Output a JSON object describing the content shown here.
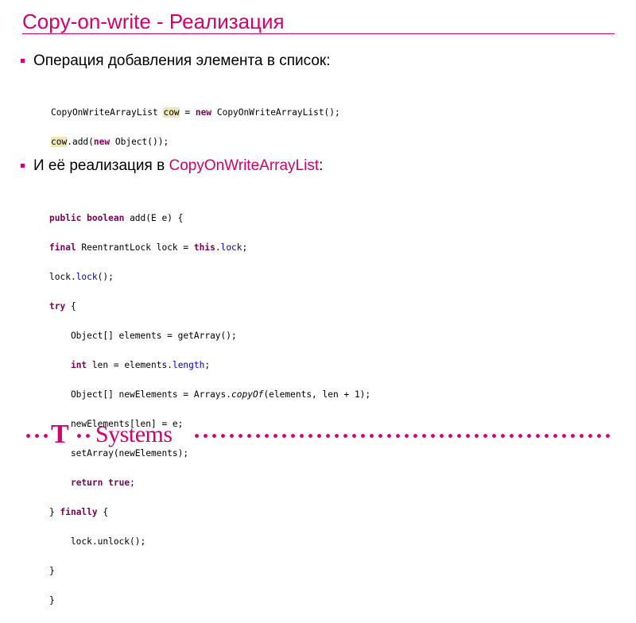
{
  "slide": {
    "title": "Copy-on-write - Реализация",
    "bullets": [
      {
        "text": "Операция добавления элемента в список:"
      },
      {
        "prefix": "И её реализация в ",
        "accent": "CopyOnWriteArrayList",
        "suffix": ":"
      }
    ],
    "code_usage": [
      "CopyOnWriteArrayList cow = new CopyOnWriteArrayList();",
      "cow.add(new Object());"
    ],
    "code_impl": [
      "public boolean add(E e) {",
      "final ReentrantLock lock = this.lock;",
      "lock.lock();",
      "try {",
      "    Object[] elements = getArray();",
      "    int len = elements.length;",
      "    Object[] newElements = Arrays.copyOf(elements, len + 1);",
      "    newElements[len] = e;",
      "    setArray(newElements);",
      "    return true;",
      "} finally {",
      "    lock.unlock();",
      "}",
      "}"
    ],
    "logo": {
      "t": "T",
      "systems": "Systems"
    },
    "colors": {
      "accent": "#d4006e",
      "keyword": "#7f0055",
      "field": "#0000c0"
    }
  }
}
